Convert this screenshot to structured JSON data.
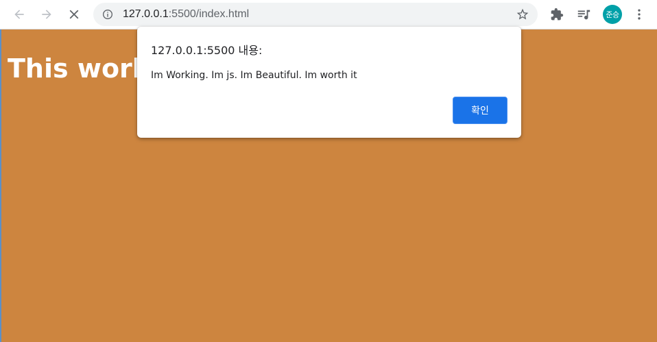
{
  "browser": {
    "url_host": "127.0.0.1",
    "url_rest": ":5500/index.html",
    "profile_initials": "준승",
    "icons": {
      "back": "arrow-back-icon",
      "forward": "arrow-forward-icon",
      "stop": "close-icon",
      "site_info": "info-icon",
      "bookmark": "star-icon",
      "extensions": "puzzle-icon",
      "media": "media-queue-icon",
      "menu": "more-vert-icon"
    }
  },
  "page": {
    "heading": "This works!",
    "background_color": "#cd853f"
  },
  "dialog": {
    "title": "127.0.0.1:5500 내용:",
    "message": "Im Working. Im js. Im Beautiful. Im worth it",
    "ok_label": "확인",
    "accent_color": "#1a73e8"
  }
}
